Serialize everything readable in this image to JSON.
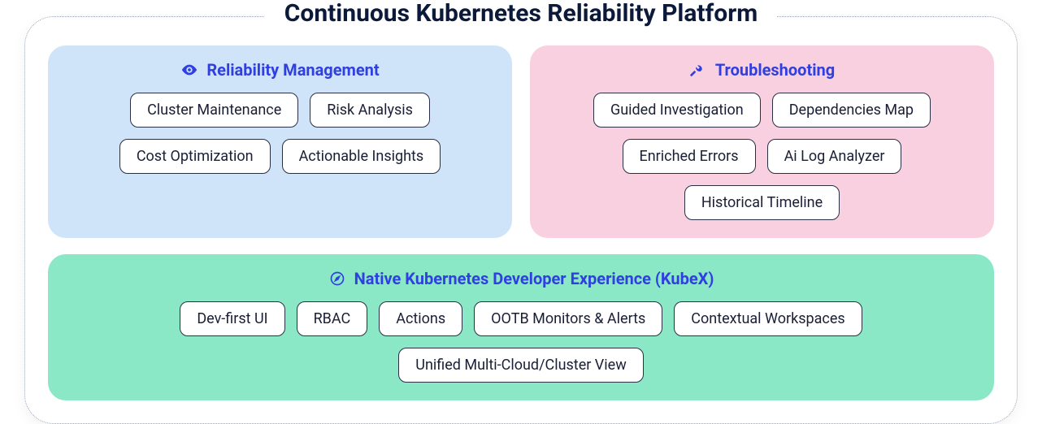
{
  "title": "Continuous Kubernetes Reliability Platform",
  "colors": {
    "accent_text": "#2f3fe0",
    "panel_blue": "#cfe4f8",
    "panel_pink": "#f9d0df",
    "panel_green": "#8be8c6"
  },
  "panels": {
    "reliability": {
      "icon": "eye-icon",
      "title": "Reliability Management",
      "items": [
        "Cluster Maintenance",
        "Risk Analysis",
        "Cost Optimization",
        "Actionable Insights"
      ]
    },
    "troubleshooting": {
      "icon": "tools-icon",
      "title": "Troubleshooting",
      "items": [
        "Guided Investigation",
        "Dependencies Map",
        "Enriched Errors",
        "Ai Log Analyzer",
        "Historical Timeline"
      ]
    },
    "kubex": {
      "icon": "compass-icon",
      "title": "Native Kubernetes Developer Experience (KubeX)",
      "items": [
        "Dev-first UI",
        "RBAC",
        "Actions",
        "OOTB Monitors & Alerts",
        "Contextual Workspaces",
        "Unified Multi-Cloud/Cluster View"
      ]
    }
  }
}
